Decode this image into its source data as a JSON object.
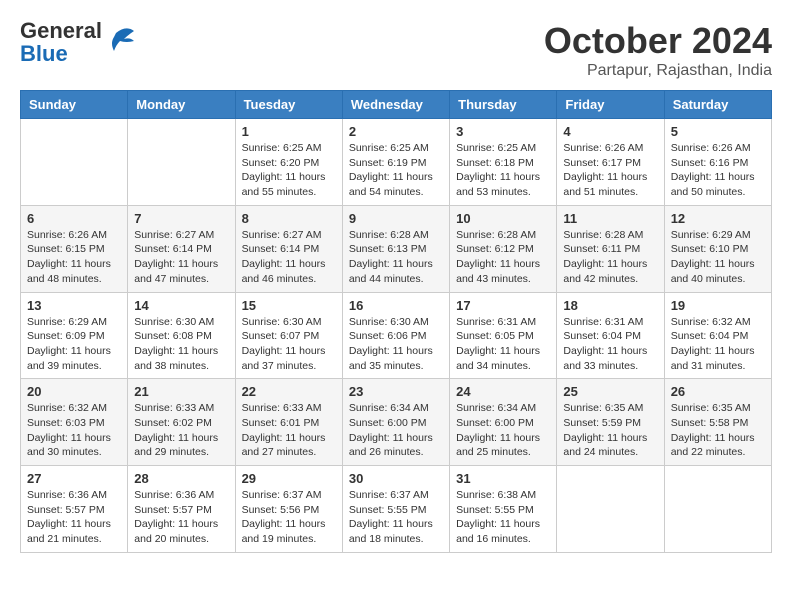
{
  "header": {
    "logo_general": "General",
    "logo_blue": "Blue",
    "month": "October 2024",
    "location": "Partapur, Rajasthan, India"
  },
  "days_of_week": [
    "Sunday",
    "Monday",
    "Tuesday",
    "Wednesday",
    "Thursday",
    "Friday",
    "Saturday"
  ],
  "weeks": [
    [
      {
        "day": "",
        "content": ""
      },
      {
        "day": "",
        "content": ""
      },
      {
        "day": "1",
        "content": "Sunrise: 6:25 AM\nSunset: 6:20 PM\nDaylight: 11 hours and 55 minutes."
      },
      {
        "day": "2",
        "content": "Sunrise: 6:25 AM\nSunset: 6:19 PM\nDaylight: 11 hours and 54 minutes."
      },
      {
        "day": "3",
        "content": "Sunrise: 6:25 AM\nSunset: 6:18 PM\nDaylight: 11 hours and 53 minutes."
      },
      {
        "day": "4",
        "content": "Sunrise: 6:26 AM\nSunset: 6:17 PM\nDaylight: 11 hours and 51 minutes."
      },
      {
        "day": "5",
        "content": "Sunrise: 6:26 AM\nSunset: 6:16 PM\nDaylight: 11 hours and 50 minutes."
      }
    ],
    [
      {
        "day": "6",
        "content": "Sunrise: 6:26 AM\nSunset: 6:15 PM\nDaylight: 11 hours and 48 minutes."
      },
      {
        "day": "7",
        "content": "Sunrise: 6:27 AM\nSunset: 6:14 PM\nDaylight: 11 hours and 47 minutes."
      },
      {
        "day": "8",
        "content": "Sunrise: 6:27 AM\nSunset: 6:14 PM\nDaylight: 11 hours and 46 minutes."
      },
      {
        "day": "9",
        "content": "Sunrise: 6:28 AM\nSunset: 6:13 PM\nDaylight: 11 hours and 44 minutes."
      },
      {
        "day": "10",
        "content": "Sunrise: 6:28 AM\nSunset: 6:12 PM\nDaylight: 11 hours and 43 minutes."
      },
      {
        "day": "11",
        "content": "Sunrise: 6:28 AM\nSunset: 6:11 PM\nDaylight: 11 hours and 42 minutes."
      },
      {
        "day": "12",
        "content": "Sunrise: 6:29 AM\nSunset: 6:10 PM\nDaylight: 11 hours and 40 minutes."
      }
    ],
    [
      {
        "day": "13",
        "content": "Sunrise: 6:29 AM\nSunset: 6:09 PM\nDaylight: 11 hours and 39 minutes."
      },
      {
        "day": "14",
        "content": "Sunrise: 6:30 AM\nSunset: 6:08 PM\nDaylight: 11 hours and 38 minutes."
      },
      {
        "day": "15",
        "content": "Sunrise: 6:30 AM\nSunset: 6:07 PM\nDaylight: 11 hours and 37 minutes."
      },
      {
        "day": "16",
        "content": "Sunrise: 6:30 AM\nSunset: 6:06 PM\nDaylight: 11 hours and 35 minutes."
      },
      {
        "day": "17",
        "content": "Sunrise: 6:31 AM\nSunset: 6:05 PM\nDaylight: 11 hours and 34 minutes."
      },
      {
        "day": "18",
        "content": "Sunrise: 6:31 AM\nSunset: 6:04 PM\nDaylight: 11 hours and 33 minutes."
      },
      {
        "day": "19",
        "content": "Sunrise: 6:32 AM\nSunset: 6:04 PM\nDaylight: 11 hours and 31 minutes."
      }
    ],
    [
      {
        "day": "20",
        "content": "Sunrise: 6:32 AM\nSunset: 6:03 PM\nDaylight: 11 hours and 30 minutes."
      },
      {
        "day": "21",
        "content": "Sunrise: 6:33 AM\nSunset: 6:02 PM\nDaylight: 11 hours and 29 minutes."
      },
      {
        "day": "22",
        "content": "Sunrise: 6:33 AM\nSunset: 6:01 PM\nDaylight: 11 hours and 27 minutes."
      },
      {
        "day": "23",
        "content": "Sunrise: 6:34 AM\nSunset: 6:00 PM\nDaylight: 11 hours and 26 minutes."
      },
      {
        "day": "24",
        "content": "Sunrise: 6:34 AM\nSunset: 6:00 PM\nDaylight: 11 hours and 25 minutes."
      },
      {
        "day": "25",
        "content": "Sunrise: 6:35 AM\nSunset: 5:59 PM\nDaylight: 11 hours and 24 minutes."
      },
      {
        "day": "26",
        "content": "Sunrise: 6:35 AM\nSunset: 5:58 PM\nDaylight: 11 hours and 22 minutes."
      }
    ],
    [
      {
        "day": "27",
        "content": "Sunrise: 6:36 AM\nSunset: 5:57 PM\nDaylight: 11 hours and 21 minutes."
      },
      {
        "day": "28",
        "content": "Sunrise: 6:36 AM\nSunset: 5:57 PM\nDaylight: 11 hours and 20 minutes."
      },
      {
        "day": "29",
        "content": "Sunrise: 6:37 AM\nSunset: 5:56 PM\nDaylight: 11 hours and 19 minutes."
      },
      {
        "day": "30",
        "content": "Sunrise: 6:37 AM\nSunset: 5:55 PM\nDaylight: 11 hours and 18 minutes."
      },
      {
        "day": "31",
        "content": "Sunrise: 6:38 AM\nSunset: 5:55 PM\nDaylight: 11 hours and 16 minutes."
      },
      {
        "day": "",
        "content": ""
      },
      {
        "day": "",
        "content": ""
      }
    ]
  ]
}
